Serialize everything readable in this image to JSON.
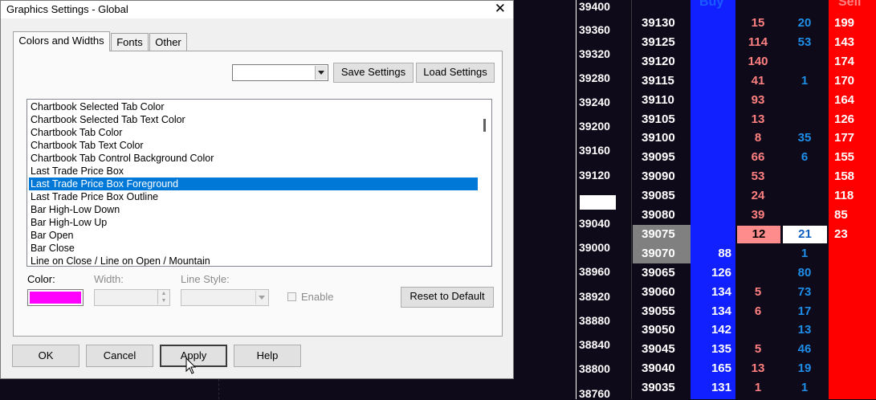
{
  "dialog": {
    "title": "Graphics Settings - Global",
    "close_glyph": "✕",
    "tabs": [
      "Colors and Widths",
      "Fonts",
      "Other"
    ],
    "combo_value": "",
    "save_settings": "Save Settings",
    "load_settings": "Load Settings",
    "list_items": [
      "Chartbook Selected Tab Color",
      "Chartbook Selected Tab Text Color",
      "Chartbook Tab Color",
      "Chartbook Tab Text Color",
      "Chartbook Tab Control Background Color",
      "Last Trade Price Box",
      "Last Trade Price Box Foreground",
      "Last Trade Price Box Outline",
      "Bar High-Low Down",
      "Bar High-Low Up",
      "Bar Open",
      "Bar Close",
      "Line on Close / Line on Open / Mountain"
    ],
    "selected_index": 6,
    "color_label": "Color:",
    "selected_color": "#ff00ff",
    "width_label": "Width:",
    "line_style_label": "Line Style:",
    "enable_label": "Enable",
    "reset_label": "Reset to Default",
    "ok_label": "OK",
    "cancel_label": "Cancel",
    "apply_label": "Apply",
    "help_label": "Help"
  },
  "axis_prices": [
    "39400",
    "39360",
    "39320",
    "39280",
    "39240",
    "39200",
    "39160",
    "39120",
    "39040",
    "39000",
    "38960",
    "38920",
    "38880",
    "38840",
    "38800",
    "38760"
  ],
  "ladder": {
    "buy_header": "Buy",
    "sell_header": "Sell",
    "colors": {
      "buy": "#1020ff",
      "sell": "#ff0000",
      "bid_text": "#ff8080",
      "ask_text": "#1e8ee8"
    },
    "rows": [
      {
        "price": "39130",
        "buy": "",
        "bidx": "15",
        "askx": "20",
        "sell": "199"
      },
      {
        "price": "39125",
        "buy": "",
        "bidx": "114",
        "askx": "53",
        "sell": "143"
      },
      {
        "price": "39120",
        "buy": "",
        "bidx": "140",
        "askx": "",
        "sell": "174"
      },
      {
        "price": "39115",
        "buy": "",
        "bidx": "41",
        "askx": "1",
        "sell": "170"
      },
      {
        "price": "39110",
        "buy": "",
        "bidx": "93",
        "askx": "",
        "sell": "164"
      },
      {
        "price": "39105",
        "buy": "",
        "bidx": "13",
        "askx": "",
        "sell": "126"
      },
      {
        "price": "39100",
        "buy": "",
        "bidx": "8",
        "askx": "35",
        "sell": "177"
      },
      {
        "price": "39095",
        "buy": "",
        "bidx": "66",
        "askx": "6",
        "sell": "155"
      },
      {
        "price": "39090",
        "buy": "",
        "bidx": "53",
        "askx": "",
        "sell": "158"
      },
      {
        "price": "39085",
        "buy": "",
        "bidx": "24",
        "askx": "",
        "sell": "118"
      },
      {
        "price": "39080",
        "buy": "",
        "bidx": "39",
        "askx": "",
        "sell": "85"
      },
      {
        "price": "39075",
        "buy": "",
        "bidx": "12",
        "askx": "21",
        "sell": "23"
      },
      {
        "price": "39070",
        "buy": "88",
        "bidx": "",
        "askx": "1",
        "sell": ""
      },
      {
        "price": "39065",
        "buy": "126",
        "bidx": "",
        "askx": "80",
        "sell": ""
      },
      {
        "price": "39060",
        "buy": "134",
        "bidx": "5",
        "askx": "73",
        "sell": ""
      },
      {
        "price": "39055",
        "buy": "134",
        "bidx": "6",
        "askx": "17",
        "sell": ""
      },
      {
        "price": "39050",
        "buy": "142",
        "bidx": "",
        "askx": "13",
        "sell": ""
      },
      {
        "price": "39045",
        "buy": "135",
        "bidx": "5",
        "askx": "46",
        "sell": ""
      },
      {
        "price": "39040",
        "buy": "165",
        "bidx": "13",
        "askx": "19",
        "sell": ""
      },
      {
        "price": "39035",
        "buy": "131",
        "bidx": "1",
        "askx": "1",
        "sell": ""
      }
    ]
  }
}
